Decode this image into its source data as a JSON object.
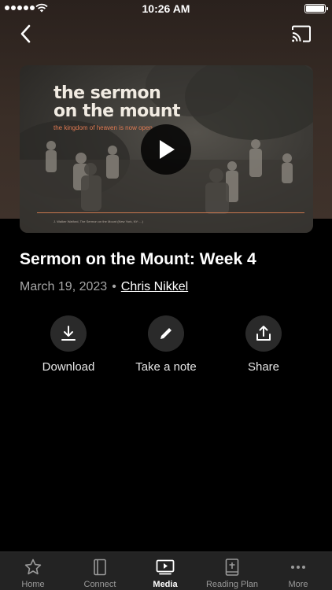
{
  "status_bar": {
    "time": "10:26 AM"
  },
  "video": {
    "thumbnail_title": "the sermon\non the mount",
    "thumbnail_subtitle": "the kingdom of heaven is now open",
    "thumbnail_credit": "J. Walker Watford, The Sermon on the Mount (New York, NY: ...)"
  },
  "sermon": {
    "title": "Sermon on the Mount: Week 4",
    "date": "March 19, 2023",
    "separator": "•",
    "author": "Chris Nikkel"
  },
  "actions": [
    {
      "label": "Download",
      "icon": "download-icon"
    },
    {
      "label": "Take a note",
      "icon": "pencil-icon"
    },
    {
      "label": "Share",
      "icon": "share-icon"
    }
  ],
  "tab_bar": {
    "active": "Media",
    "items": [
      {
        "label": "Home",
        "icon": "star-icon"
      },
      {
        "label": "Connect",
        "icon": "book-icon"
      },
      {
        "label": "Media",
        "icon": "play-screen-icon"
      },
      {
        "label": "Reading Plan",
        "icon": "bible-icon"
      },
      {
        "label": "More",
        "icon": "ellipsis-icon"
      }
    ]
  },
  "colors": {
    "header_bg": "#3a2e27",
    "accent": "#e07a52",
    "tab_bar_bg": "#232323"
  }
}
